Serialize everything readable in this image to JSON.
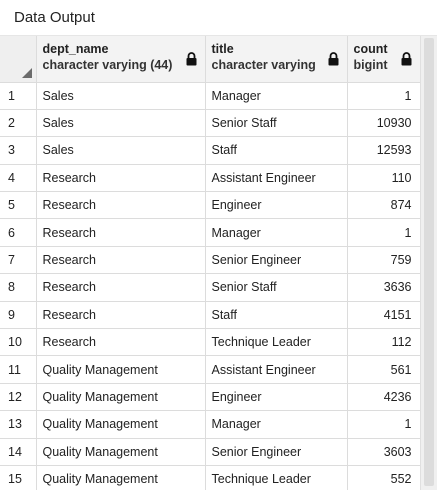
{
  "panel": {
    "title": "Data Output"
  },
  "columns": [
    {
      "name": "dept_name",
      "type": "character varying (44)",
      "icon": "lock-icon"
    },
    {
      "name": "title",
      "type": "character varying",
      "icon": "lock-icon"
    },
    {
      "name": "count",
      "type": "bigint",
      "icon": "lock-icon"
    }
  ],
  "rows": [
    {
      "n": "1",
      "dept": "Sales",
      "title": "Manager",
      "count": "1"
    },
    {
      "n": "2",
      "dept": "Sales",
      "title": "Senior Staff",
      "count": "10930"
    },
    {
      "n": "3",
      "dept": "Sales",
      "title": "Staff",
      "count": "12593"
    },
    {
      "n": "4",
      "dept": "Research",
      "title": "Assistant Engineer",
      "count": "110"
    },
    {
      "n": "5",
      "dept": "Research",
      "title": "Engineer",
      "count": "874"
    },
    {
      "n": "6",
      "dept": "Research",
      "title": "Manager",
      "count": "1"
    },
    {
      "n": "7",
      "dept": "Research",
      "title": "Senior Engineer",
      "count": "759"
    },
    {
      "n": "8",
      "dept": "Research",
      "title": "Senior Staff",
      "count": "3636"
    },
    {
      "n": "9",
      "dept": "Research",
      "title": "Staff",
      "count": "4151"
    },
    {
      "n": "10",
      "dept": "Research",
      "title": "Technique Leader",
      "count": "112"
    },
    {
      "n": "11",
      "dept": "Quality Management",
      "title": "Assistant Engineer",
      "count": "561"
    },
    {
      "n": "12",
      "dept": "Quality Management",
      "title": "Engineer",
      "count": "4236"
    },
    {
      "n": "13",
      "dept": "Quality Management",
      "title": "Manager",
      "count": "1"
    },
    {
      "n": "14",
      "dept": "Quality Management",
      "title": "Senior Engineer",
      "count": "3603"
    },
    {
      "n": "15",
      "dept": "Quality Management",
      "title": "Technique Leader",
      "count": "552"
    }
  ]
}
